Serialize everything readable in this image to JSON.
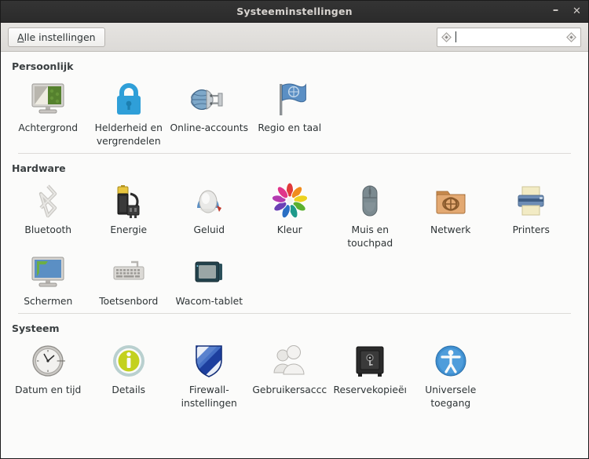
{
  "window": {
    "title": "Systeeminstellingen",
    "controls": [
      {
        "name": "minimize-button",
        "glyph": "–"
      },
      {
        "name": "close-button",
        "glyph": "✕"
      }
    ]
  },
  "toolbar": {
    "all_settings_label": "Alle instellingen",
    "all_settings_mnemonic": "A",
    "all_settings_rest": "lle instellingen",
    "search_value": "",
    "search_placeholder": "",
    "search_left_icon": "missing-image-icon",
    "search_right_icon": "missing-image-icon"
  },
  "sections": [
    {
      "title": "Persoonlijk",
      "items": [
        {
          "icon": "background-monitor-icon",
          "label": "Achtergrond"
        },
        {
          "icon": "lock-brightness-icon",
          "label": "Helderheid en vergrendelen"
        },
        {
          "icon": "online-accounts-globe-plug-icon",
          "label": "Online-accounts"
        },
        {
          "icon": "region-flag-icon",
          "label": "Regio en taal"
        }
      ]
    },
    {
      "title": "Hardware",
      "items": [
        {
          "icon": "bluetooth-icon",
          "label": "Bluetooth"
        },
        {
          "icon": "battery-power-icon",
          "label": "Energie"
        },
        {
          "icon": "sound-speaker-icon",
          "label": "Geluid"
        },
        {
          "icon": "color-wheel-icon",
          "label": "Kleur"
        },
        {
          "icon": "mouse-icon",
          "label": "Muis en touchpad"
        },
        {
          "icon": "network-folder-icon",
          "label": "Netwerk"
        },
        {
          "icon": "printer-icon",
          "label": "Printers"
        },
        {
          "icon": "displays-monitor-icon",
          "label": "Schermen"
        },
        {
          "icon": "keyboard-icon",
          "label": "Toetsenbord"
        },
        {
          "icon": "wacom-tablet-icon",
          "label": "Wacom-tablet"
        }
      ]
    },
    {
      "title": "Systeem",
      "items": [
        {
          "icon": "clock-icon",
          "label": "Datum en tijd"
        },
        {
          "icon": "info-details-icon",
          "label": "Details"
        },
        {
          "icon": "firewall-shield-icon",
          "label": "Firewall-instellingen"
        },
        {
          "icon": "users-group-icon",
          "label": "Gebruikersaccc"
        },
        {
          "icon": "safe-backup-icon",
          "label": "Reservekopieëı"
        },
        {
          "icon": "universal-access-icon",
          "label": "Universele toegang"
        }
      ]
    }
  ],
  "colors": {
    "titlebar": "#2e2e2e",
    "titlebar_text": "#d8d4d0",
    "toolbar": "#e0dedb",
    "content_bg": "#fbfbfa",
    "divider": "#dddbd8",
    "label_text": "#2e3436"
  }
}
